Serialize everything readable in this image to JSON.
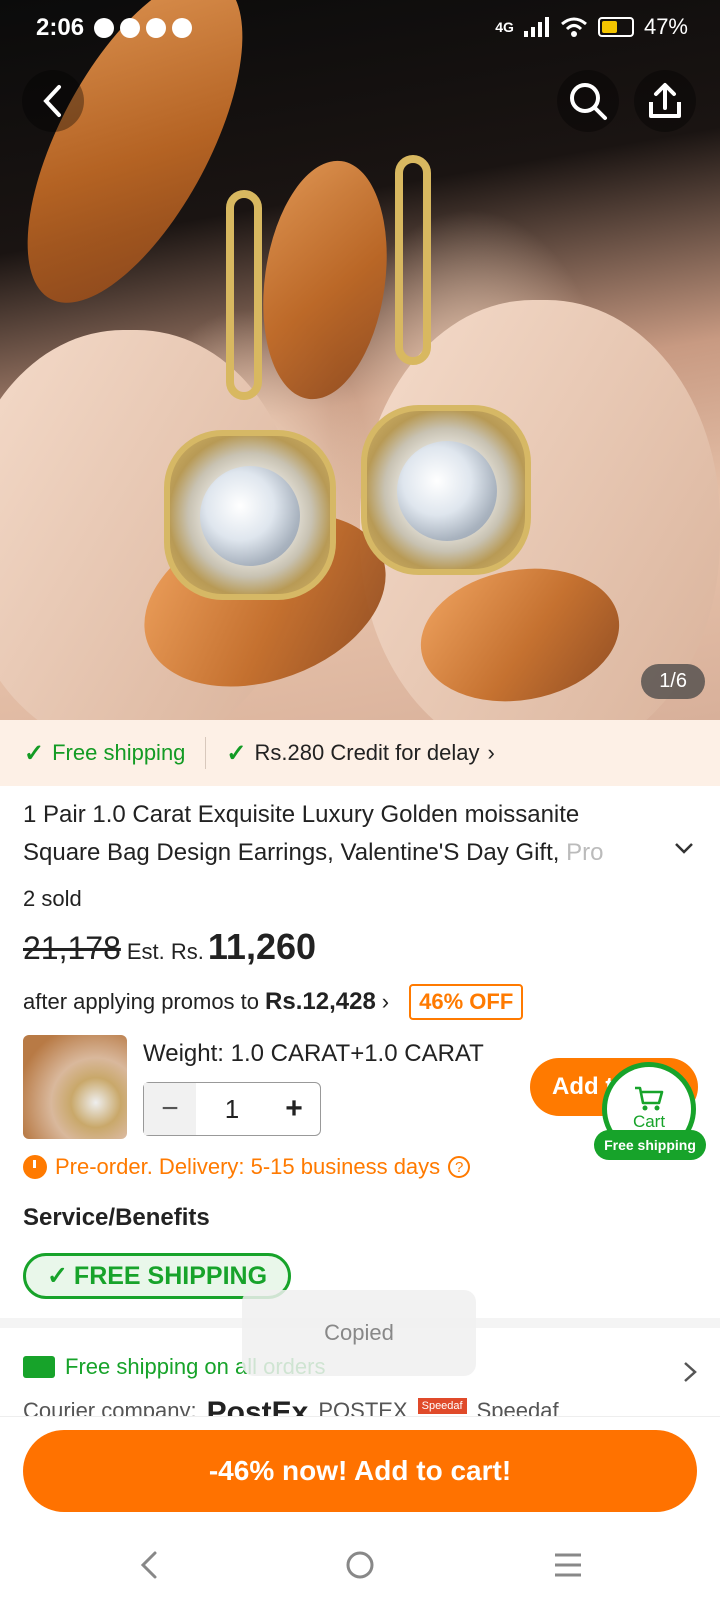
{
  "status_bar": {
    "time": "2:06",
    "battery": "47%",
    "network": "4G"
  },
  "gallery": {
    "counter": "1/6"
  },
  "shipping_strip": {
    "free_shipping": "Free shipping",
    "credit": "Rs.280 Credit for delay"
  },
  "product": {
    "title": "1 Pair 1.0 Carat Exquisite Luxury Golden moissanite Square Bag Design Earrings, Valentine'S Day Gift, ",
    "title_fade": "Pro",
    "sold": "2 sold",
    "old_price": "21,178",
    "est_label": "Est. Rs.",
    "price": "11,260",
    "promo_prefix": "after applying promos to",
    "promo_price": "Rs.12,428",
    "discount": "46% OFF",
    "weight": "Weight: 1.0 CARAT+1.0 CARAT",
    "quantity": "1",
    "add_button": "Add t",
    "cart_label": "Cart",
    "cart_free_shipping": "Free shipping",
    "preorder": "Pre-order. Delivery: 5-15 business days"
  },
  "service": {
    "heading": "Service/Benefits",
    "badge": "FREE SHIPPING"
  },
  "toast": {
    "text": "Copied"
  },
  "shipping_info": {
    "free_all": "Free shipping on all orders",
    "courier_label": "Courier company:",
    "courier1_logo": "PostEx",
    "courier1": "POSTEX",
    "courier2_logo": "Speedaf",
    "courier2": "Speedaf"
  },
  "cta": {
    "label": "-46% now! Add to cart!"
  },
  "colors": {
    "accent": "#ff7a00",
    "green": "#17a32a"
  }
}
